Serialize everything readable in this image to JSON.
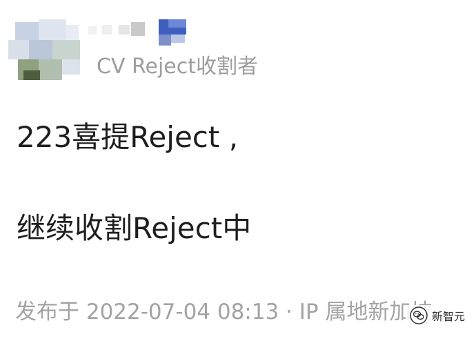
{
  "post": {
    "author": "CV Reject收割者",
    "lines": [
      "223喜提Reject ,",
      "继续收割Reject中"
    ],
    "meta": "发布于 2022-07-04 08:13 · IP 属地新加坡",
    "watermark": "新智元"
  },
  "colors": {
    "author": "#9d9d9d",
    "body": "#1e1e1e",
    "meta": "#a3a3a3",
    "background": "#ffffff"
  },
  "icons": {
    "avatar": "avatar-icon",
    "watermark": "wechat-logo-icon"
  }
}
